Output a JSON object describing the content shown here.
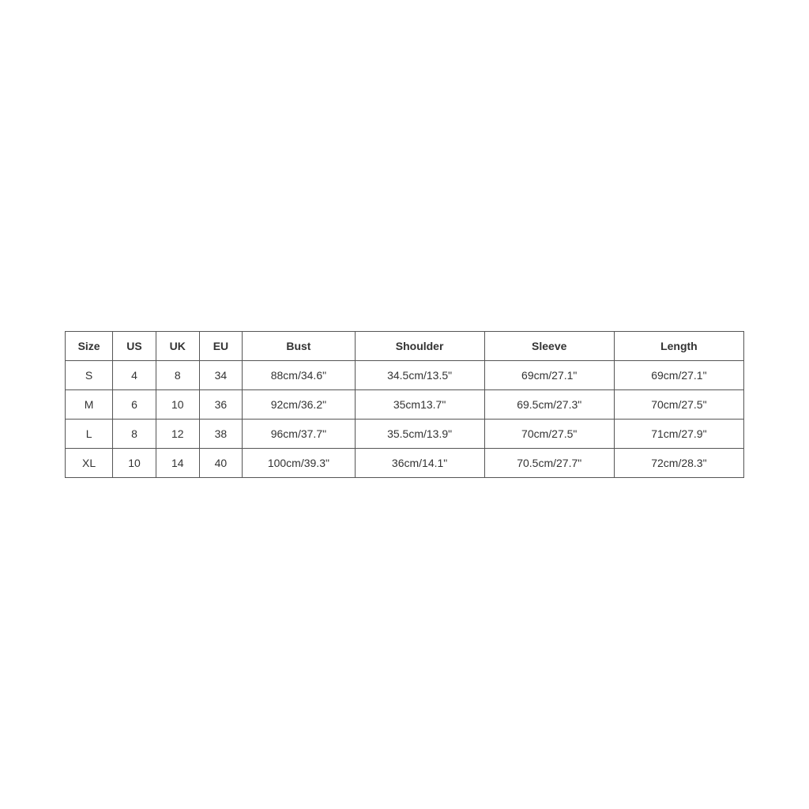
{
  "table": {
    "headers": [
      "Size",
      "US",
      "UK",
      "EU",
      "Bust",
      "Shoulder",
      "Sleeve",
      "Length"
    ],
    "rows": [
      {
        "size": "S",
        "us": "4",
        "uk": "8",
        "eu": "34",
        "bust": "88cm/34.6\"",
        "shoulder": "34.5cm/13.5\"",
        "sleeve": "69cm/27.1\"",
        "length": "69cm/27.1\""
      },
      {
        "size": "M",
        "us": "6",
        "uk": "10",
        "eu": "36",
        "bust": "92cm/36.2\"",
        "shoulder": "35cm13.7\"",
        "sleeve": "69.5cm/27.3\"",
        "length": "70cm/27.5\""
      },
      {
        "size": "L",
        "us": "8",
        "uk": "12",
        "eu": "38",
        "bust": "96cm/37.7\"",
        "shoulder": "35.5cm/13.9\"",
        "sleeve": "70cm/27.5\"",
        "length": "71cm/27.9\""
      },
      {
        "size": "XL",
        "us": "10",
        "uk": "14",
        "eu": "40",
        "bust": "100cm/39.3\"",
        "shoulder": "36cm/14.1\"",
        "sleeve": "70.5cm/27.7\"",
        "length": "72cm/28.3\""
      }
    ]
  }
}
